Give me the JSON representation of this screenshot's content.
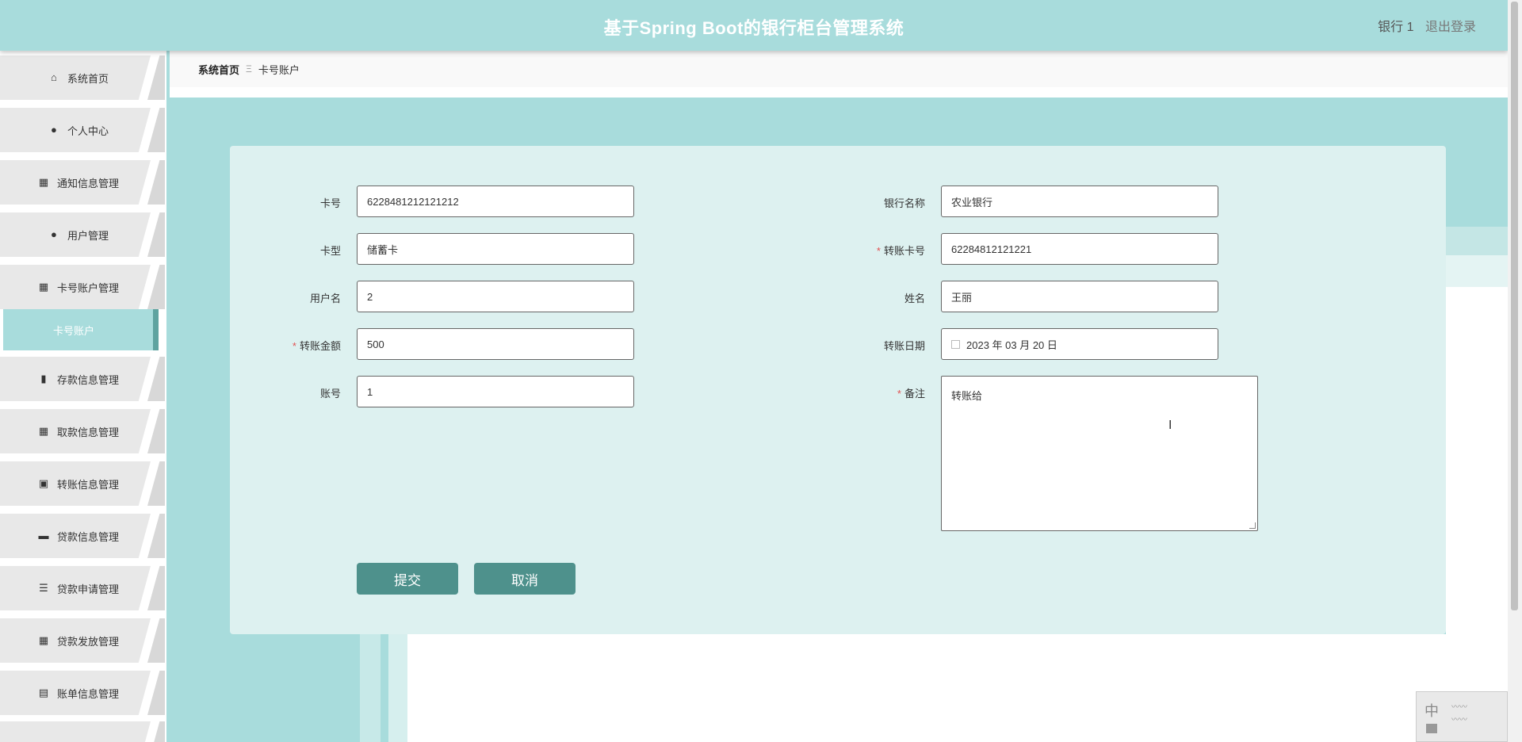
{
  "header": {
    "title": "基于Spring Boot的银行柜台管理系统",
    "user": "银行 1",
    "logout": "退出登录"
  },
  "sidebar": {
    "items": [
      {
        "label": "系统首页",
        "icon": "home-icon",
        "glyph": "⌂"
      },
      {
        "label": "个人中心",
        "icon": "user-icon",
        "glyph": "●"
      },
      {
        "label": "通知信息管理",
        "icon": "grid-icon",
        "glyph": "▦"
      },
      {
        "label": "用户管理",
        "icon": "bulb-icon",
        "glyph": "●"
      },
      {
        "label": "卡号账户管理",
        "icon": "grid-icon",
        "glyph": "▦"
      },
      {
        "label": "卡号账户",
        "icon": "",
        "glyph": ""
      },
      {
        "label": "存款信息管理",
        "icon": "bar-chart-icon",
        "glyph": "▮"
      },
      {
        "label": "取款信息管理",
        "icon": "grid-icon",
        "glyph": "▦"
      },
      {
        "label": "转账信息管理",
        "icon": "clipboard-x-icon",
        "glyph": "▣"
      },
      {
        "label": "贷款信息管理",
        "icon": "briefcase-icon",
        "glyph": "▬"
      },
      {
        "label": "贷款申请管理",
        "icon": "sliders-icon",
        "glyph": "☰"
      },
      {
        "label": "贷款发放管理",
        "icon": "grid-icon",
        "glyph": "▦"
      },
      {
        "label": "账单信息管理",
        "icon": "clipboard-icon",
        "glyph": "▤"
      }
    ]
  },
  "breadcrumb": {
    "home": "系统首页",
    "separator": "Ξ",
    "current": "卡号账户"
  },
  "form": {
    "card_no": {
      "label": "卡号",
      "value": "6228481212121212"
    },
    "card_type": {
      "label": "卡型",
      "value": "储蓄卡"
    },
    "username": {
      "label": "用户名",
      "value": "2"
    },
    "amount": {
      "label": "转账金额",
      "value": "500",
      "required": true
    },
    "account": {
      "label": "账号",
      "value": "1"
    },
    "bank_name": {
      "label": "银行名称",
      "value": "农业银行"
    },
    "transfer_card": {
      "label": "转账卡号",
      "value": "62284812121221",
      "required": true
    },
    "name": {
      "label": "姓名",
      "value": "王丽"
    },
    "date": {
      "label": "转账日期",
      "value": "2023 年 03 月 20 日"
    },
    "remark": {
      "label": "备注",
      "value": "转账给",
      "required": true
    },
    "submit": "提交",
    "cancel": "取消"
  },
  "ime": {
    "mode": "中"
  },
  "colors": {
    "accent": "#a8dcdc",
    "panel": "#ddf1f0",
    "button": "#4e918c",
    "required": "#e25252"
  }
}
